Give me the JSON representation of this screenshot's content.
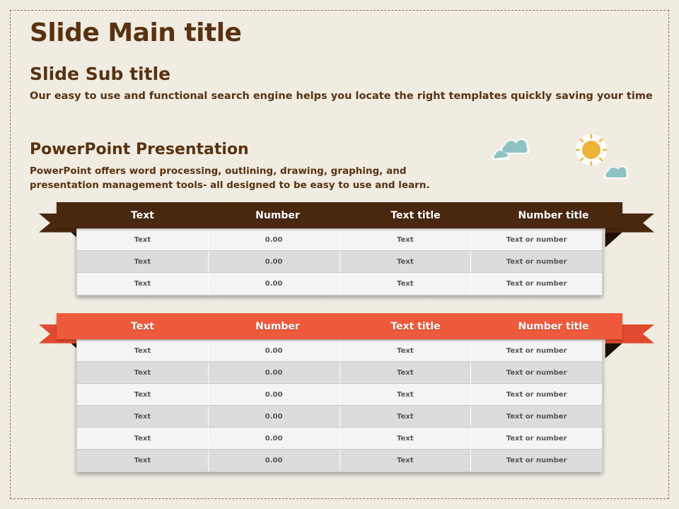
{
  "slide": {
    "main_title": "Slide Main title",
    "sub_title": "Slide Sub title",
    "sub_text": "Our easy to use and functional search engine helps you locate the right templates quickly saving your time",
    "section_title": "PowerPoint Presentation",
    "section_text_line1": "PowerPoint offers word processing, outlining, drawing, graphing, and",
    "section_text_line2": "presentation management tools- all designed to be easy to use and learn."
  },
  "colors": {
    "title_brown": "#5a3210",
    "ribbon_brown": "#4a2810",
    "ribbon_red": "#ef5a3c",
    "cloud": "#8fc3c3",
    "sun": "#f1b43a"
  },
  "decor_icons": [
    "cloud-icon",
    "cloud-icon",
    "sun-icon",
    "cloud-icon"
  ],
  "table1": {
    "headers": [
      "Text",
      "Number",
      "Text title",
      "Number title"
    ],
    "rows": [
      [
        "Text",
        "0.00",
        "Text",
        "Text or number"
      ],
      [
        "Text",
        "0.00",
        "Text",
        "Text or number"
      ],
      [
        "Text",
        "0.00",
        "Text",
        "Text or number"
      ]
    ]
  },
  "table2": {
    "headers": [
      "Text",
      "Number",
      "Text title",
      "Number title"
    ],
    "rows": [
      [
        "Text",
        "0.00",
        "Text",
        "Text or number"
      ],
      [
        "Text",
        "0.00",
        "Text",
        "Text or number"
      ],
      [
        "Text",
        "0.00",
        "Text",
        "Text or number"
      ],
      [
        "Text",
        "0.00",
        "Text",
        "Text or number"
      ],
      [
        "Text",
        "0.00",
        "Text",
        "Text or number"
      ],
      [
        "Text",
        "0.00",
        "Text",
        "Text or number"
      ]
    ]
  }
}
